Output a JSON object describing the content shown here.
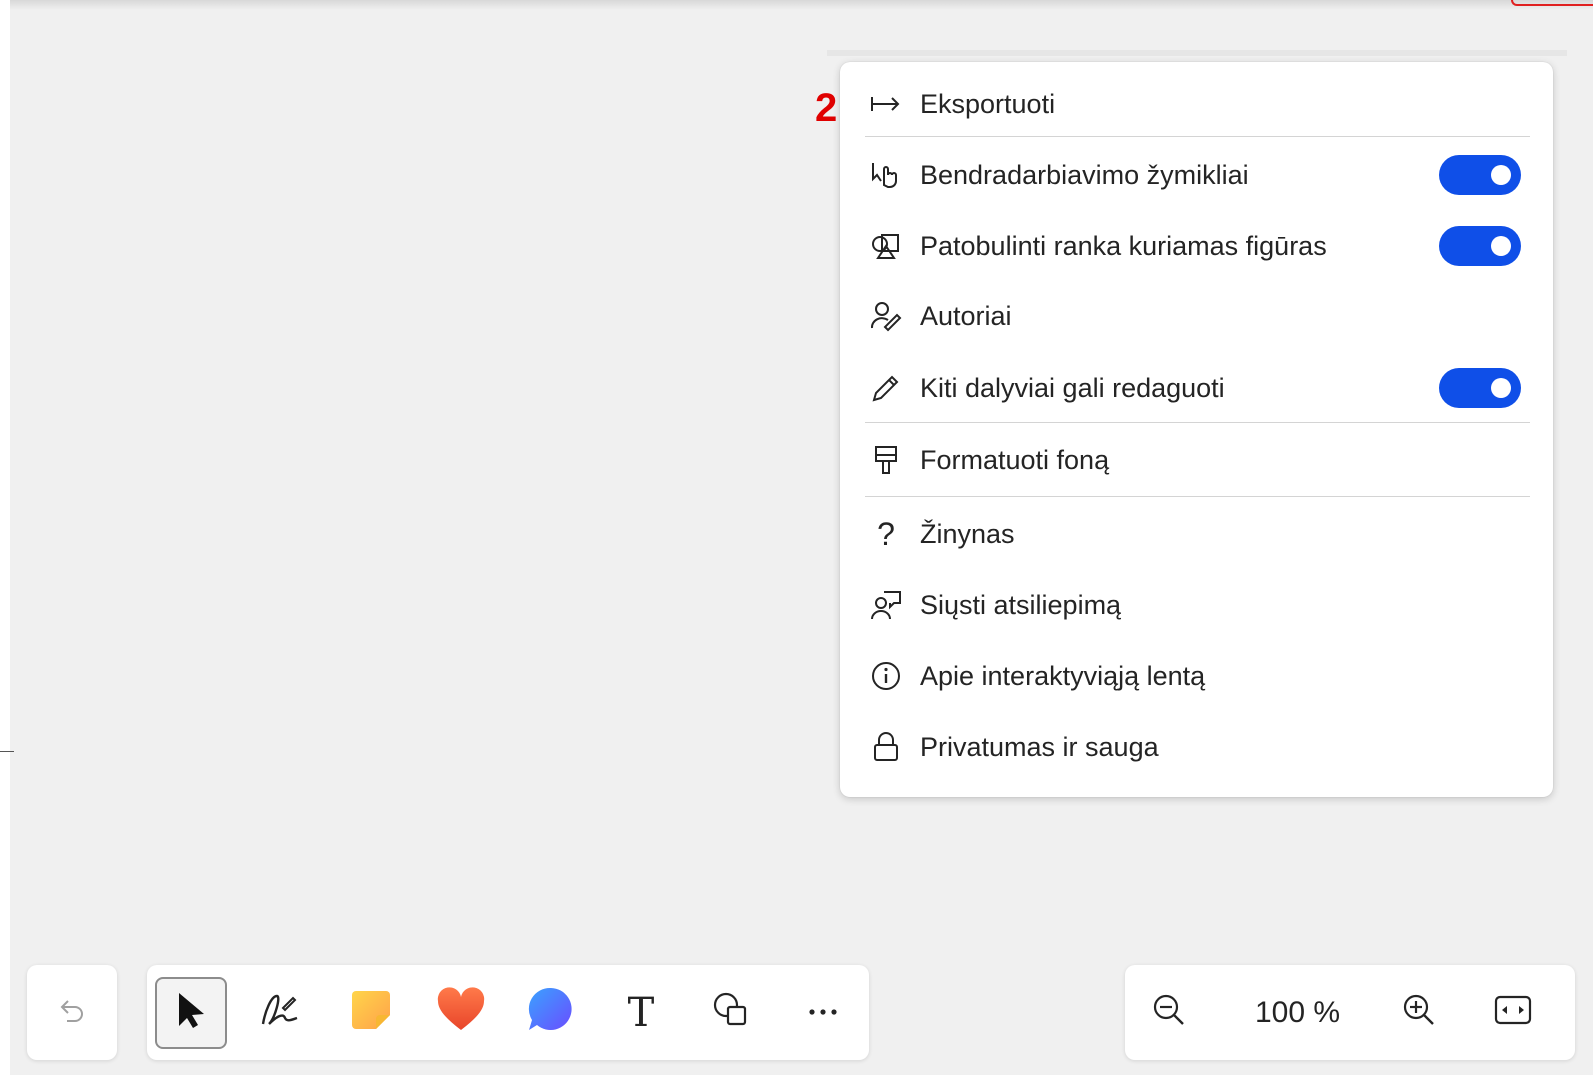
{
  "badge": "2",
  "menu": {
    "items": [
      {
        "label": "Eksportuoti",
        "icon": "export-icon"
      },
      {
        "label": "Bendradarbiavimo žymikliai",
        "icon": "collaboration-cursor-icon",
        "toggle": true
      },
      {
        "label": "Patobulinti ranka kuriamas figūras",
        "icon": "shapes-icon",
        "toggle": true
      },
      {
        "label": "Autoriai",
        "icon": "person-edit-icon"
      },
      {
        "label": "Kiti dalyviai gali redaguoti",
        "icon": "pencil-icon",
        "toggle": true
      },
      {
        "label": "Formatuoti foną",
        "icon": "paint-brush-icon"
      },
      {
        "label": "Žinynas",
        "icon": "question-icon"
      },
      {
        "label": "Siųsti atsiliepimą",
        "icon": "feedback-icon"
      },
      {
        "label": "Apie interaktyviąją lentą",
        "icon": "info-icon"
      },
      {
        "label": "Privatumas ir sauga",
        "icon": "lock-icon"
      }
    ]
  },
  "toolbar": {
    "tools": [
      "undo-icon",
      "select-icon",
      "pen-icon",
      "sticky-note-icon",
      "reaction-icon",
      "comment-icon",
      "text-icon",
      "shapes-icon",
      "more-icon"
    ]
  },
  "zoom": {
    "value": "100 %"
  },
  "colors": {
    "toggle_on": "#0f4fe8",
    "badge": "#e00000",
    "canvas": "#f0f0f0"
  }
}
